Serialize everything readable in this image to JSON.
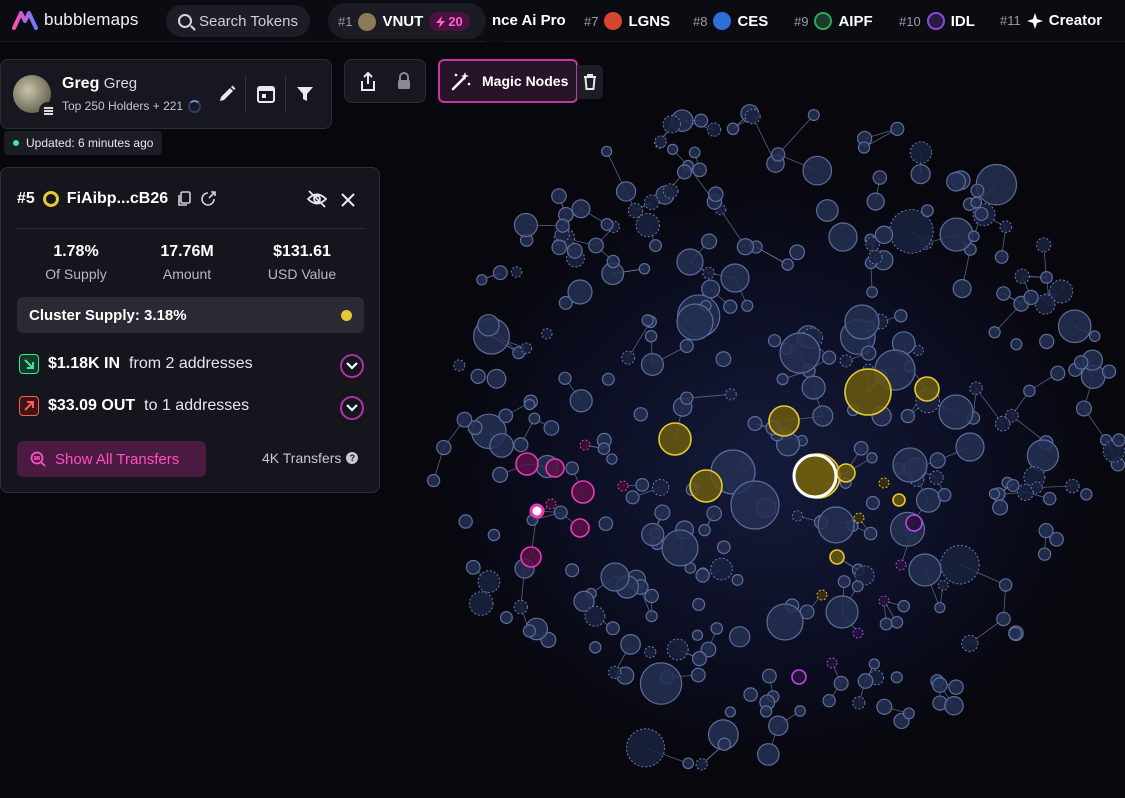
{
  "app": {
    "logo_text": "bubblemaps"
  },
  "search": {
    "placeholder": "Search Tokens"
  },
  "ticker": [
    {
      "rank": "#1",
      "symbol": "VNUT",
      "boost": "20",
      "icon_color": "#8a7a56"
    },
    {
      "rank": "",
      "symbol": "nce Ai Pro",
      "icon_color": ""
    },
    {
      "rank": "#7",
      "symbol": "LGNS",
      "icon_color": "#d8452e"
    },
    {
      "rank": "#8",
      "symbol": "CES",
      "icon_color": "#2f6fd8"
    },
    {
      "rank": "#9",
      "symbol": "AIPF",
      "icon_color": "#2fa85a"
    },
    {
      "rank": "#10",
      "symbol": "IDL",
      "icon_color": "#8a4ad8"
    },
    {
      "rank": "#11",
      "symbol": "Creator",
      "icon_color": "#ffffff"
    }
  ],
  "user": {
    "name": "Greg",
    "handle": "Greg",
    "subtitle": "Top 250 Holders + 221",
    "updated": "Updated: 6 minutes ago"
  },
  "toolbar": {
    "magic_nodes_label": "Magic Nodes"
  },
  "wallet": {
    "rank": "#5",
    "address": "FiAibp...cB26",
    "stats": [
      {
        "value": "1.78%",
        "label": "Of Supply"
      },
      {
        "value": "17.76M",
        "label": "Amount"
      },
      {
        "value": "$131.61",
        "label": "USD Value"
      }
    ],
    "cluster_supply": "Cluster Supply: 3.18%",
    "flow_in": {
      "amount": "$1.18K IN",
      "detail": "from 2 addresses"
    },
    "flow_out": {
      "amount": "$33.09 OUT",
      "detail": "to 1 addresses"
    },
    "show_all_label": "Show All Transfers",
    "transfers_count": "4K Transfers"
  },
  "colors": {
    "accent_pink": "#e83ab8",
    "cluster_yellow": "#e8c832",
    "bubble_default": "#26304f",
    "selected_outline": "#ffffff"
  }
}
